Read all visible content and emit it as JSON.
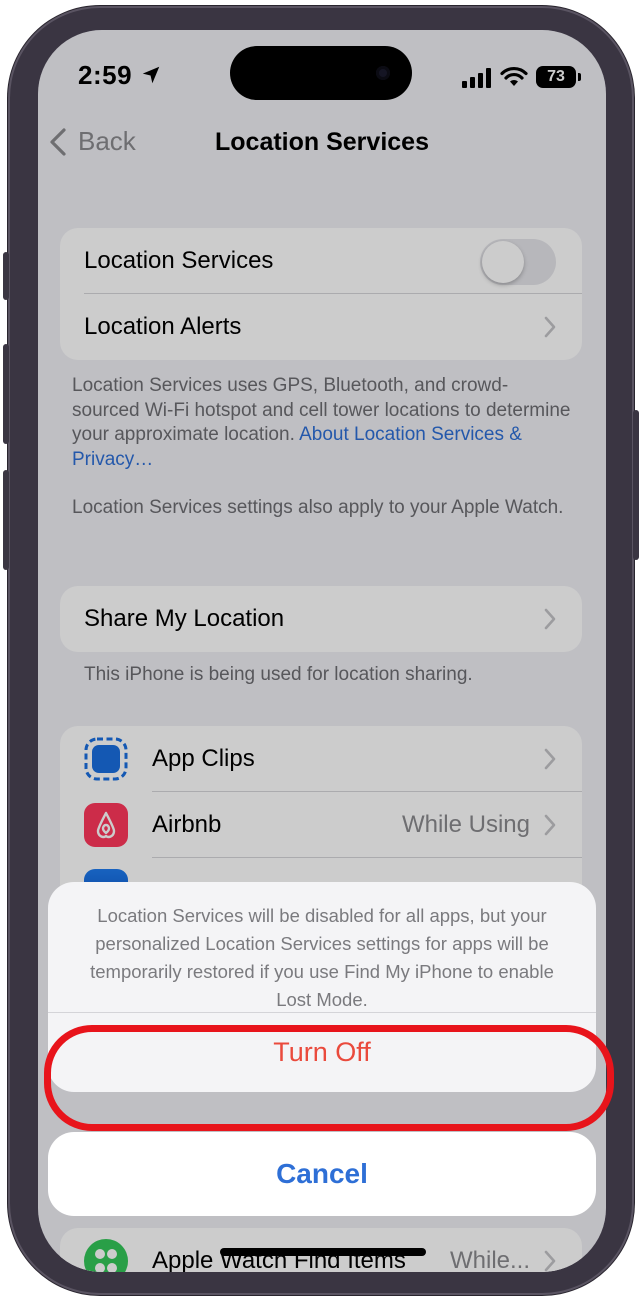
{
  "status_bar": {
    "time": "2:59",
    "battery": "73"
  },
  "nav": {
    "back_label": "Back",
    "title": "Location Services"
  },
  "group_main": {
    "location_services_label": "Location Services",
    "location_services_enabled": false,
    "location_alerts_label": "Location Alerts"
  },
  "footnote_1": {
    "text": "Location Services uses GPS, Bluetooth, and crowd-sourced Wi-Fi hotspot and cell tower locations to determine your approximate location.",
    "link": "About Location Services & Privacy…"
  },
  "footnote_2": "Location Services settings also apply to your Apple Watch.",
  "share": {
    "label": "Share My Location",
    "footnote": "This iPhone is being used for location sharing."
  },
  "apps": [
    {
      "name": "App Clips",
      "detail": ""
    },
    {
      "name": "Airbnb",
      "detail": "While Using"
    }
  ],
  "bottom_app": {
    "name": "Apple Watch Find Items",
    "detail": "While..."
  },
  "sheet": {
    "message": "Location Services will be disabled for all apps, but your personalized Location Services settings for apps will be temporarily restored if you use Find My iPhone to enable Lost Mode.",
    "turn_off_label": "Turn Off",
    "cancel_label": "Cancel"
  },
  "colors": {
    "destructive": "#ea4a3c",
    "link": "#2e6fd6",
    "highlight_ring": "#e8141b"
  }
}
